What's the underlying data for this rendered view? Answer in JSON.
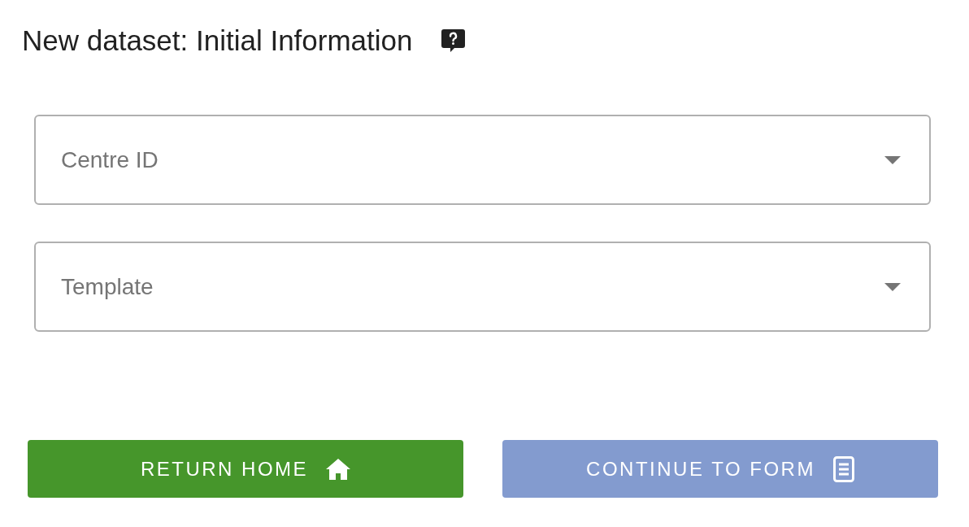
{
  "title": "New dataset: Initial Information",
  "fields": [
    {
      "placeholder": "Centre ID",
      "kind": "select"
    },
    {
      "placeholder": "Template",
      "kind": "select"
    }
  ],
  "buttons": [
    {
      "label": "RETURN HOME",
      "kind": "success",
      "disabled": false
    },
    {
      "label": "CONTINUE TO FORM",
      "kind": "primary",
      "disabled": true
    }
  ]
}
